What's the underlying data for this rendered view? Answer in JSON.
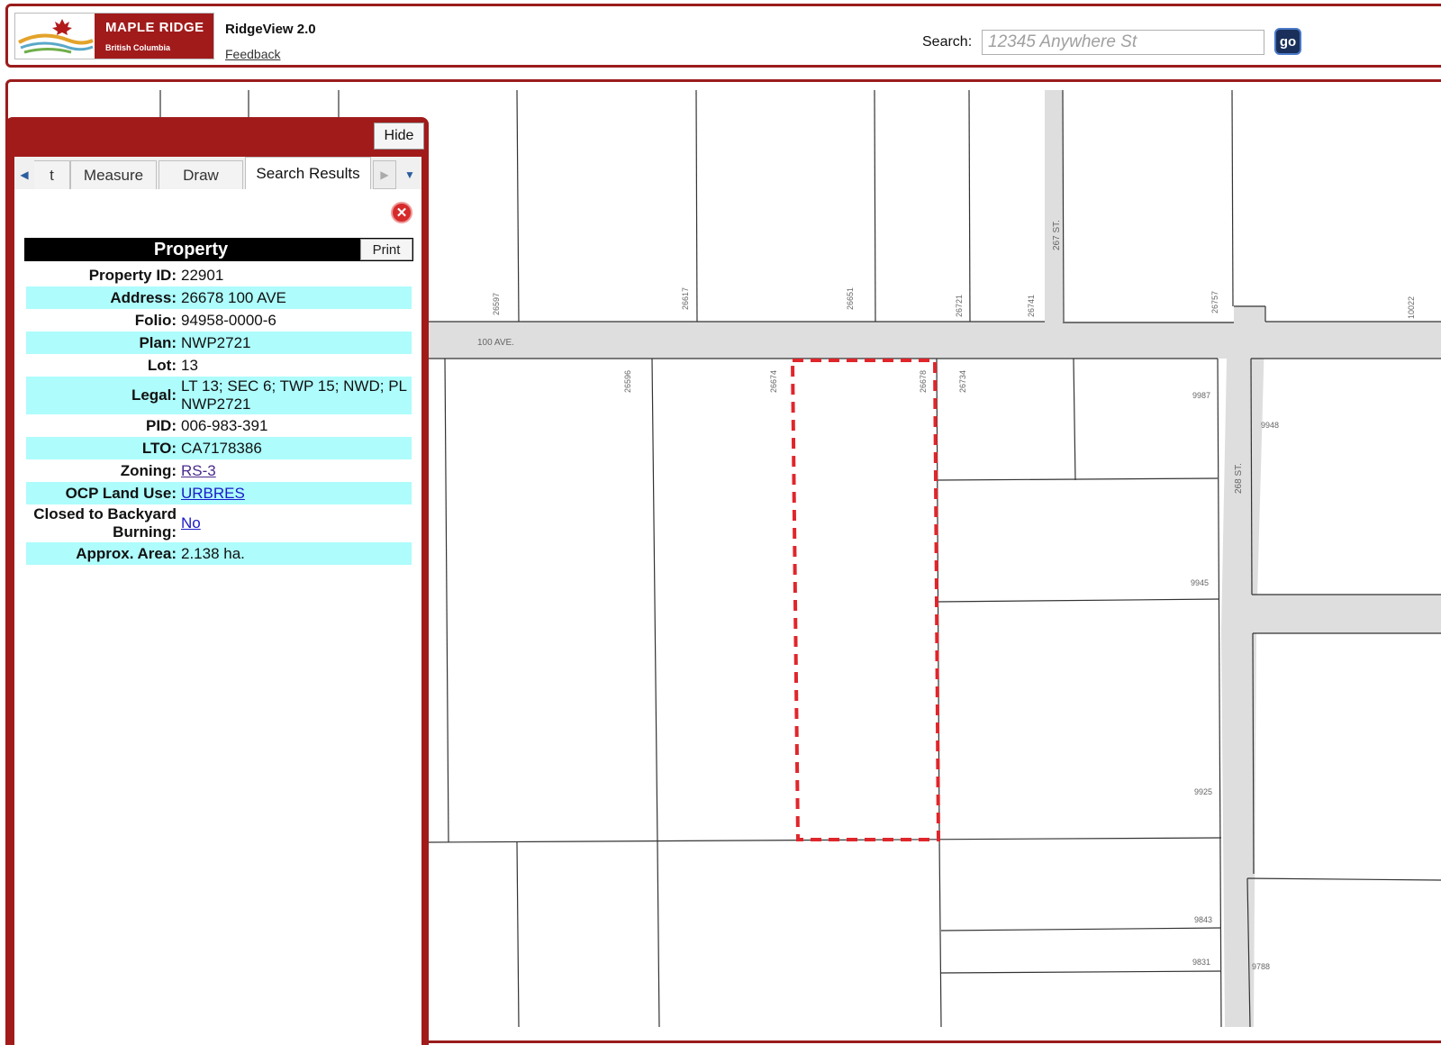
{
  "header": {
    "logo_name": "MAPLE RIDGE",
    "logo_region": "British Columbia",
    "app_title": "RidgeView 2.0",
    "feedback_label": "Feedback",
    "search_label": "Search:",
    "search_placeholder": "12345 Anywhere St",
    "go_label": "go"
  },
  "panel": {
    "hide_label": "Hide",
    "tabs": [
      {
        "label": "t"
      },
      {
        "label": "Measure"
      },
      {
        "label": "Draw"
      },
      {
        "label": "Search Results",
        "active": true
      }
    ],
    "property_title": "Property",
    "print_label": "Print",
    "fields": [
      {
        "label": "Property ID:",
        "value": "22901"
      },
      {
        "label": "Address:",
        "value": "26678 100 AVE"
      },
      {
        "label": "Folio:",
        "value": "94958-0000-6"
      },
      {
        "label": "Plan:",
        "value": "NWP2721"
      },
      {
        "label": "Lot:",
        "value": "13"
      },
      {
        "label": "Legal:",
        "value": "LT 13; SEC 6; TWP 15; NWD; PL NWP2721"
      },
      {
        "label": "PID:",
        "value": "006-983-391"
      },
      {
        "label": "LTO:",
        "value": "CA7178386"
      },
      {
        "label": "Zoning:",
        "value": "RS-3"
      },
      {
        "label": "OCP Land Use:",
        "value": "URBRES"
      },
      {
        "label": "Closed to Backyard Burning:",
        "value": "No"
      },
      {
        "label": "Approx. Area:",
        "value": "2.138 ha."
      }
    ]
  },
  "map": {
    "streets": {
      "ave_100": "100 AVE.",
      "st_267": "267 ST.",
      "st_268": "268 ST."
    },
    "addresses": [
      "26597",
      "26617",
      "26651",
      "26721",
      "26741",
      "26757",
      "10022",
      "26596",
      "26674",
      "26678",
      "26734",
      "9987",
      "9948",
      "9945",
      "9925",
      "9843",
      "9831",
      "9788"
    ],
    "selection_color": "#e0262b"
  }
}
